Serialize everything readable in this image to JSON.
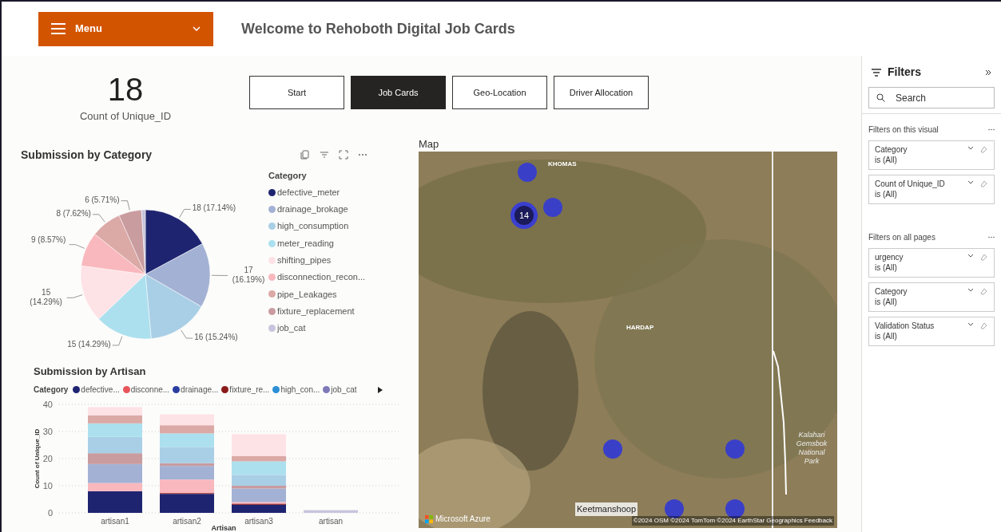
{
  "header": {
    "menu_label": "Menu",
    "title": "Welcome to Rehoboth Digital Job Cards"
  },
  "card": {
    "value": "18",
    "label": "Count of Unique_ID"
  },
  "nav_buttons": [
    {
      "label": "Start",
      "selected": false
    },
    {
      "label": "Job Cards",
      "selected": true
    },
    {
      "label": "Geo-Location",
      "selected": false
    },
    {
      "label": "Driver Allocation",
      "selected": false
    }
  ],
  "category_chart": {
    "title": "Submission by Category",
    "legend_title": "Category",
    "chart_data": {
      "type": "pie",
      "categories": [
        "defective_meter",
        "drainage_brokage",
        "high_consumption",
        "meter_reading",
        "shifting_pipes",
        "disconnection_recon...",
        "pipe_Leakages",
        "fixture_replacement",
        "job_cat"
      ],
      "values": [
        18,
        17,
        16,
        15,
        15,
        9,
        8,
        6,
        1
      ],
      "colors": [
        "#1f2470",
        "#a3b1d4",
        "#a9cfe6",
        "#ace0ee",
        "#fde2e6",
        "#f9b8bd",
        "#dba9a6",
        "#c99c9f",
        "#c8c4dc"
      ],
      "value_labels": [
        "18 (17.14%)",
        "17 (16.19%)",
        "16 (15.24%)",
        "15 (14.29%)",
        "15 (14.29%)",
        "9 (8.57%)",
        "8 (7.62%)",
        "6 (5.71%)",
        null
      ]
    }
  },
  "artisan_chart": {
    "title": "Submission by Artisan",
    "legend_title": "Category",
    "legend": [
      {
        "label": "defective...",
        "color": "#1f2470"
      },
      {
        "label": "disconne...",
        "color": "#e8545a"
      },
      {
        "label": "drainage...",
        "color": "#2a3ea0"
      },
      {
        "label": "fixture_re...",
        "color": "#8b1a1a"
      },
      {
        "label": "high_con...",
        "color": "#2b8fd6"
      },
      {
        "label": "job_cat",
        "color": "#7e7ab8"
      }
    ],
    "chart_data": {
      "type": "bar",
      "stacked": true,
      "grid": true,
      "xlabel": "Artisan",
      "ylabel": "Count of Unique_ID",
      "categories": [
        "artisan1",
        "artisan2",
        "artisan3",
        "artisan"
      ],
      "ylim": [
        0,
        40
      ],
      "yticks": [
        0,
        10,
        20,
        30,
        40
      ],
      "series": [
        {
          "color": "#1f2470",
          "values": [
            8,
            7,
            3,
            0
          ]
        },
        {
          "color": "#8b1a1a",
          "values": [
            0,
            0.3,
            0.4,
            0
          ]
        },
        {
          "color": "#f9b8bd",
          "values": [
            3,
            5,
            0.6,
            0
          ]
        },
        {
          "color": "#a3b1d4",
          "values": [
            7,
            5,
            5,
            0
          ]
        },
        {
          "color": "#c99c9f",
          "values": [
            4,
            1,
            1,
            0
          ]
        },
        {
          "color": "#a9cfe6",
          "values": [
            6,
            6,
            4,
            0
          ]
        },
        {
          "color": "#ace0ee",
          "values": [
            5,
            5,
            5,
            0
          ]
        },
        {
          "color": "#dba9a6",
          "values": [
            3,
            3,
            2,
            0
          ]
        },
        {
          "color": "#fde2e6",
          "values": [
            3,
            4,
            8,
            0
          ]
        },
        {
          "color": "#c8c4dc",
          "values": [
            0,
            0,
            0,
            1
          ]
        }
      ]
    }
  },
  "map": {
    "title": "Map",
    "labels": [
      {
        "text": "KHOMAS",
        "kind": "region"
      },
      {
        "text": "HARDAP",
        "kind": "region"
      },
      {
        "text": "Keetmanshoop",
        "kind": "city"
      },
      {
        "text": "Kalahari Gemsbok National Park",
        "kind": "park"
      }
    ],
    "markers": [
      {
        "kind": "point"
      },
      {
        "kind": "cluster",
        "count": "14"
      },
      {
        "kind": "point"
      },
      {
        "kind": "point"
      },
      {
        "kind": "point"
      },
      {
        "kind": "point"
      },
      {
        "kind": "point"
      }
    ],
    "brand": "Microsoft Azure",
    "attribution": "©2024 OSM ©2024 TomTom ©2024 EarthStar Geographics Feedback"
  },
  "filters": {
    "title": "Filters",
    "search_placeholder": "Search",
    "sections": [
      {
        "heading": "Filters on this visual",
        "items": [
          {
            "field": "Category",
            "value": "is (All)"
          },
          {
            "field": "Count of Unique_ID",
            "value": "is (All)"
          }
        ]
      },
      {
        "heading": "Filters on all pages",
        "items": [
          {
            "field": "urgency",
            "value": "is (All)"
          },
          {
            "field": "Category",
            "value": "is (All)"
          },
          {
            "field": "Validation Status",
            "value": "is (All)"
          }
        ]
      }
    ]
  }
}
